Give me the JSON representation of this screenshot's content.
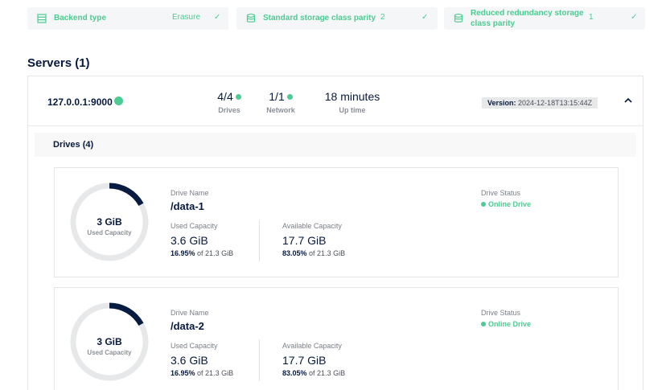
{
  "info_cards": {
    "backend": {
      "label": "Backend type",
      "value": "Erasure",
      "icon": "storage-icon",
      "check_icon": "check-icon"
    },
    "standard_parity": {
      "label": "Standard storage class parity",
      "value": "2",
      "icon": "database-icon",
      "check_icon": "check-icon"
    },
    "reduced_parity": {
      "label": "Reduced redundancy storage class parity",
      "value": "1",
      "icon": "database-icon",
      "check_icon": "check-icon"
    }
  },
  "servers": {
    "heading": "Servers (1)",
    "server": {
      "endpoint": "127.0.0.1:9000",
      "drives_value": "4/4",
      "drives_caption": "Drives",
      "network_value": "1/1",
      "network_caption": "Network",
      "uptime_value": "18 minutes",
      "uptime_caption": "Up time",
      "version_label": "Version:",
      "version_value": "2024-12-18T13:15:44Z",
      "collapse_icon": "chevron-up-icon"
    }
  },
  "drives": {
    "title": "Drives (4)",
    "items": [
      {
        "ring_value": "3 GiB",
        "ring_caption": "Used Capacity",
        "used_fraction": 0.1695,
        "name_label": "Drive Name",
        "name": "/data-1",
        "used_label": "Used Capacity",
        "used_value": "3.6 GiB",
        "used_pct": "16.95%",
        "used_of": "of 21.3 GiB",
        "avail_label": "Available Capacity",
        "avail_value": "17.7 GiB",
        "avail_pct": "83.05%",
        "avail_of": "of 21.3 GiB",
        "status_label": "Drive Status",
        "status_value": "Online Drive"
      },
      {
        "ring_value": "3 GiB",
        "ring_caption": "Used Capacity",
        "used_fraction": 0.1695,
        "name_label": "Drive Name",
        "name": "/data-2",
        "used_label": "Used Capacity",
        "used_value": "3.6 GiB",
        "used_pct": "16.95%",
        "used_of": "of 21.3 GiB",
        "avail_label": "Available Capacity",
        "avail_value": "17.7 GiB",
        "avail_pct": "83.05%",
        "avail_of": "of 21.3 GiB",
        "status_label": "Drive Status",
        "status_value": "Online Drive"
      }
    ]
  },
  "colors": {
    "accent_green": "#4ccb92",
    "navy": "#07193e",
    "ring_track": "#e6e8e9"
  }
}
